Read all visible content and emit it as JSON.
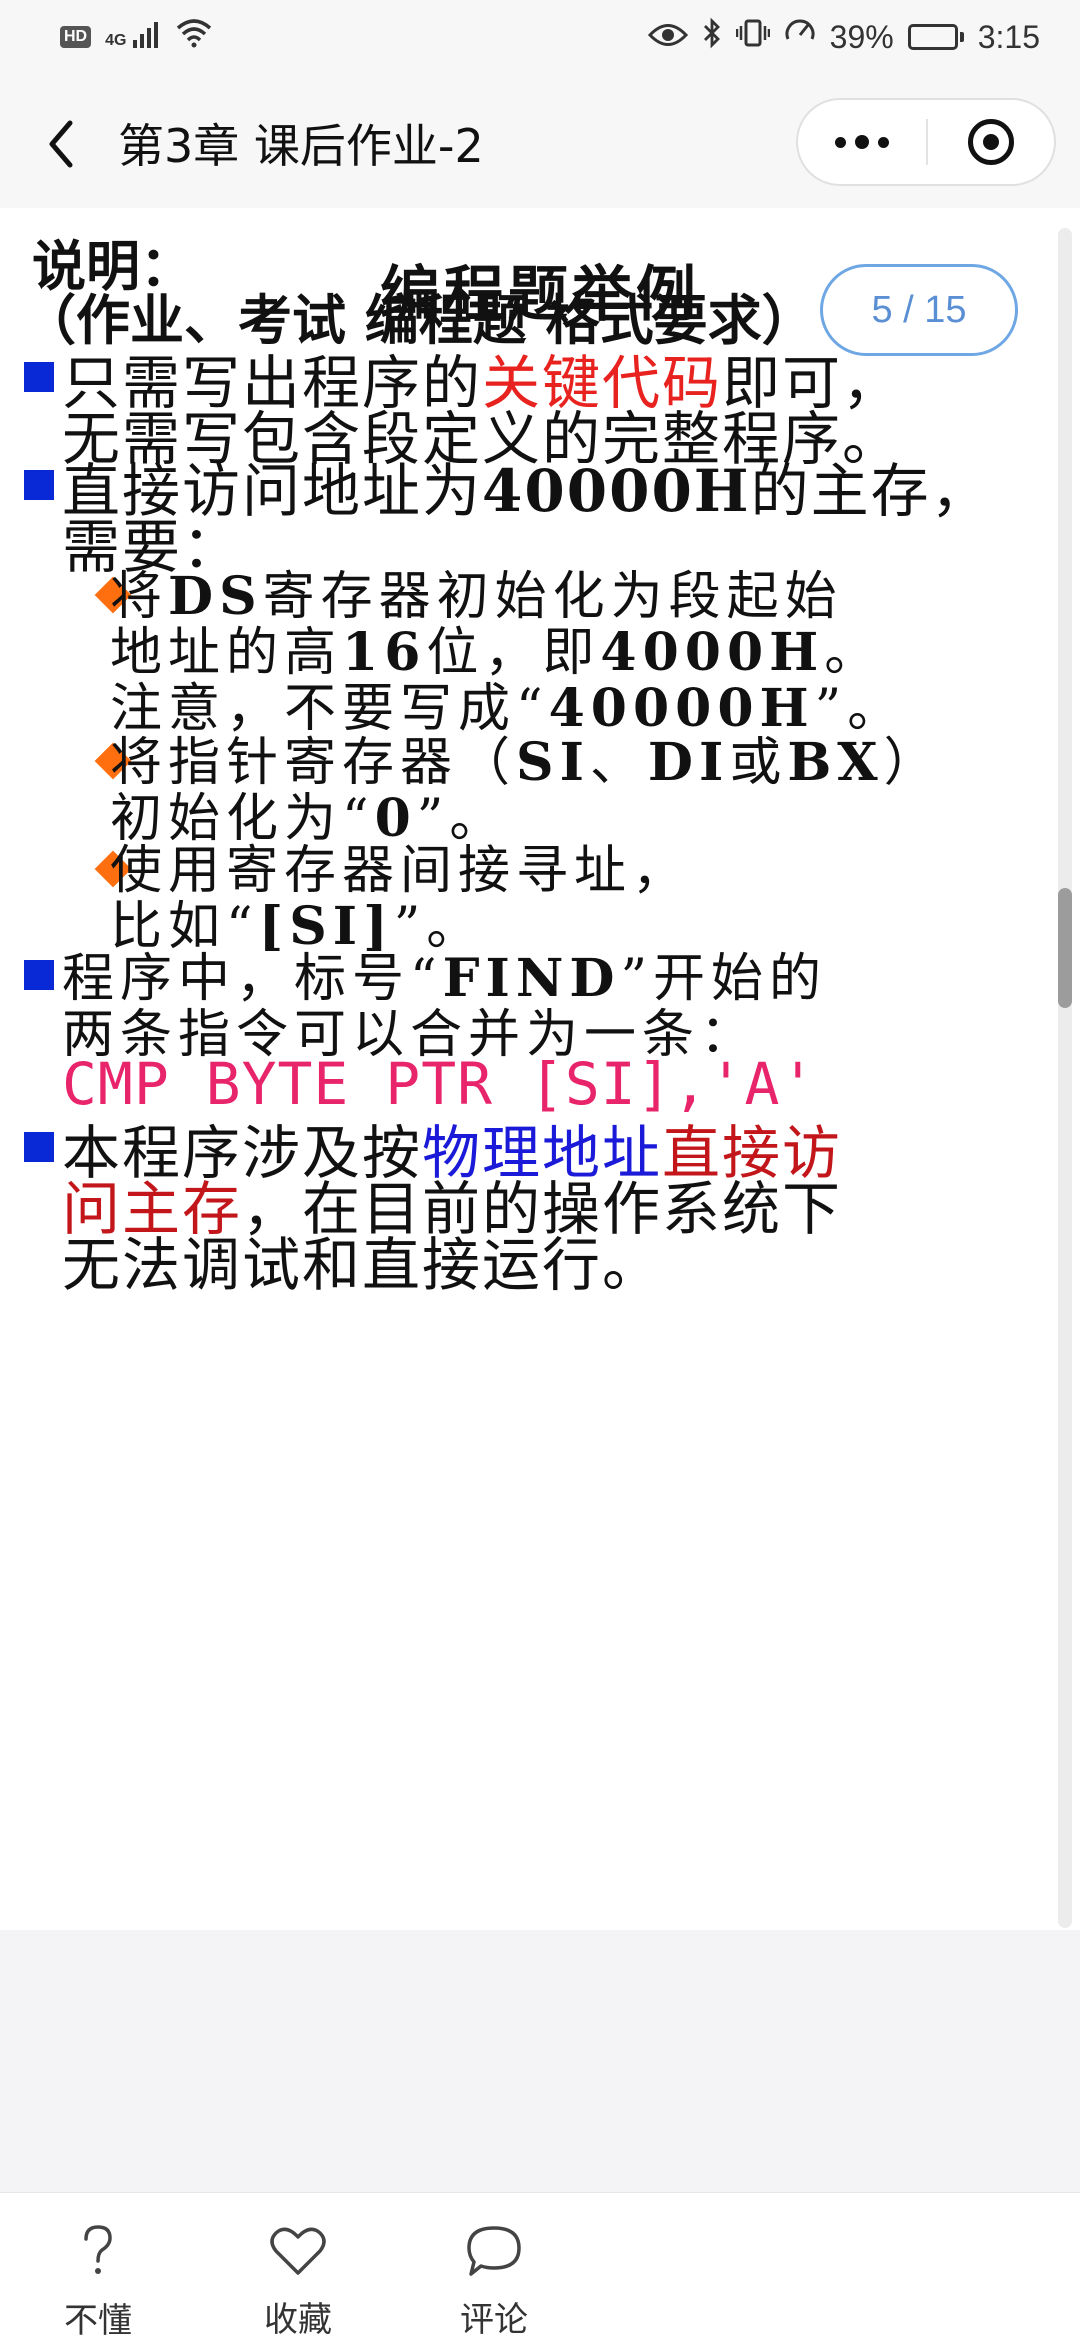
{
  "status_bar": {
    "hd_badge": "HD",
    "network": "4G",
    "battery_text": "39%",
    "battery_level": 0.39,
    "time": "3:15"
  },
  "header": {
    "title": "第3章 课后作业-2"
  },
  "slide": {
    "title": "编程题举例",
    "page_indicator": "5 / 15",
    "heading1": "说明：",
    "heading2": "（作业、考试 编程题 格式要求）",
    "b1_a": "只需写出程序的",
    "b1_b": "关键代码",
    "b1_c": "即可，",
    "b1_line2": "无需写包含段定义的完整程序。",
    "b2_a": "直接访问地址为",
    "b2_b": "40000H",
    "b2_c": "的主存，",
    "b2_line2": "需要：",
    "s1_a": "将",
    "s1_b": "DS",
    "s1_c": "寄存器初始化为段起始",
    "s1_line2_a": "地址的高",
    "s1_line2_b": "16",
    "s1_line2_c": "位，即",
    "s1_line2_d": "4000H",
    "s1_line2_e": "。",
    "s1_line3_a": "注意，不要写成“",
    "s1_line3_b": "40000H",
    "s1_line3_c": "”。",
    "s2_a": "将指针寄存器（",
    "s2_b": "SI",
    "s2_c": "、",
    "s2_d": "DI",
    "s2_e": "或",
    "s2_f": "BX",
    "s2_g": "）",
    "s2_line2_a": "初始化为“",
    "s2_line2_b": "0",
    "s2_line2_c": "”。",
    "s3_line1": "使用寄存器间接寻址，",
    "s3_line2_a": "比如“",
    "s3_line2_b": "[SI]",
    "s3_line2_c": "”。",
    "b3_a": "程序中，标号“",
    "b3_b": "FIND",
    "b3_c": "”开始的",
    "b3_line2": "两条指令可以合并为一条：",
    "code": "CMP BYTE PTR [SI],'A'",
    "b4_a": "本程序涉及按",
    "b4_b": "物理地址",
    "b4_c": "直接访",
    "b4_line2_a": "问主存",
    "b4_line2_b": "，在目前的操作系统下",
    "b4_line3": "无法调试和直接运行。"
  },
  "bottom_bar": {
    "tabs": [
      {
        "label": "不懂",
        "icon": "question-icon"
      },
      {
        "label": "收藏",
        "icon": "heart-icon"
      },
      {
        "label": "评论",
        "icon": "comment-icon"
      }
    ]
  },
  "colors": {
    "square_bullet": "#0a29d6",
    "diamond_bullet": "#ff6e0f",
    "highlight_red": "#e8231f",
    "highlight_blue": "#1a1ad8",
    "code_pink": "#e8246a",
    "indicator_blue": "#5b8fd4"
  }
}
